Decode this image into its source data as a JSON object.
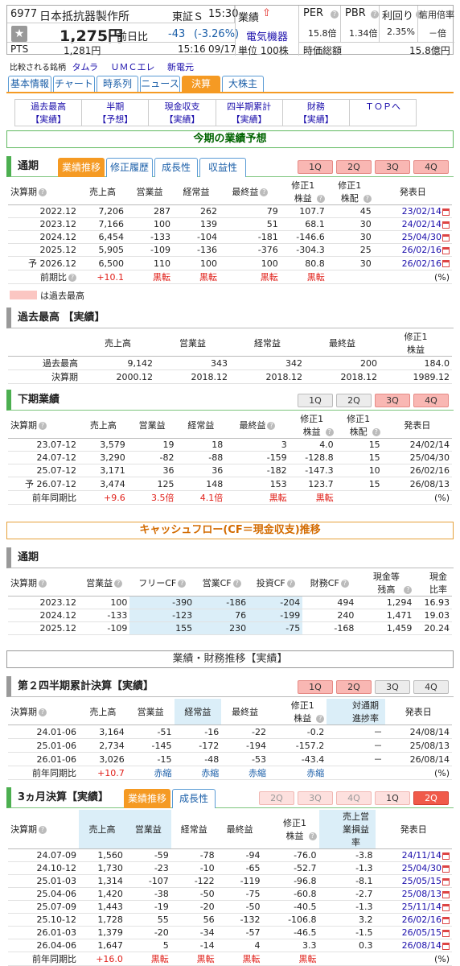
{
  "header": {
    "code": "6977",
    "name": "日本抵抗器製作所",
    "market": "東証Ｓ",
    "time": "15:30",
    "price": "1,275円",
    "prev_label": "前日比",
    "change": "-43",
    "change_pct": "(-3.26%)",
    "sector_label": "業績",
    "sector": "電気機器",
    "unit": "単位 100株",
    "per_label": "PER",
    "per": "15.8倍",
    "pbr_label": "PBR",
    "pbr": "1.34倍",
    "yield_label": "利回り",
    "yield": "2.35%",
    "margin_label": "信用倍率",
    "margin": "－倍",
    "pts_label": "PTS",
    "pts_price": "1,281円",
    "pts_time": "15:16",
    "pts_date": "09/17",
    "mcap_label": "時価総額",
    "mcap": "15.8億円",
    "compare_label": "比較される銘柄",
    "compare": [
      "タムラ",
      "ＵＭＣエレ",
      "新電元"
    ]
  },
  "tabs": [
    "基本情報",
    "チャート",
    "時系列",
    "ニュース",
    "決算",
    "大株主"
  ],
  "subnav": [
    [
      "過去最高",
      "【実績】"
    ],
    [
      "半期",
      "【予想】"
    ],
    [
      "現金収支",
      "【実績】"
    ],
    [
      "四半期累計",
      "【実績】"
    ],
    [
      "財務",
      "【実績】"
    ],
    [
      "ＴＯＰへ",
      ""
    ]
  ],
  "forecast": {
    "title": "今期の業績予想",
    "bar": "通期",
    "tabs": [
      "業績推移",
      "修正履歴",
      "成長性",
      "収益性"
    ],
    "q": [
      "1Q",
      "2Q",
      "3Q",
      "4Q"
    ],
    "headers": [
      "決算期",
      "売上高",
      "営業益",
      "経常益",
      "最終益",
      "修正1株益",
      "修正1株配",
      "発表日"
    ],
    "rows": [
      [
        "2022.12",
        "7,206",
        "287",
        "262",
        "79",
        "107.7",
        "45",
        "23/02/14"
      ],
      [
        "2023.12",
        "7,166",
        "100",
        "139",
        "51",
        "68.1",
        "30",
        "24/02/14"
      ],
      [
        "2024.12",
        "6,454",
        "-133",
        "-104",
        "-181",
        "-146.6",
        "30",
        "25/04/30"
      ],
      [
        "2025.12",
        "5,905",
        "-109",
        "-136",
        "-376",
        "-304.3",
        "25",
        "26/02/16"
      ],
      [
        "予 2026.12",
        "6,500",
        "110",
        "100",
        "100",
        "80.8",
        "30",
        "26/02/16"
      ]
    ],
    "cmp": [
      "前期比",
      "+10.1",
      "黒転",
      "黒転",
      "黒転",
      "黒転",
      "",
      "(%)"
    ],
    "legend": "は過去最高"
  },
  "record": {
    "bar": "過去最高 【実績】",
    "headers": [
      "売上高",
      "営業益",
      "経常益",
      "最終益",
      "修正1株益"
    ],
    "rows": [
      [
        "過去最高",
        "9,142",
        "343",
        "342",
        "200",
        "184.0"
      ],
      [
        "決算期",
        "2000.12",
        "2018.12",
        "2018.12",
        "2018.12",
        "1989.12"
      ]
    ]
  },
  "half": {
    "bar": "下期業績",
    "q": [
      "1Q",
      "2Q",
      "3Q",
      "4Q"
    ],
    "headers": [
      "決算期",
      "売上高",
      "営業益",
      "経常益",
      "最終益",
      "修正1株益",
      "修正1株配",
      "発表日"
    ],
    "rows": [
      [
        "23.07-12",
        "3,579",
        "19",
        "18",
        "3",
        "4.0",
        "15",
        "24/02/14"
      ],
      [
        "24.07-12",
        "3,290",
        "-82",
        "-88",
        "-159",
        "-128.8",
        "15",
        "25/04/30"
      ],
      [
        "25.07-12",
        "3,171",
        "36",
        "36",
        "-182",
        "-147.3",
        "10",
        "26/02/16"
      ],
      [
        "予 26.07-12",
        "3,474",
        "125",
        "148",
        "153",
        "123.7",
        "15",
        "26/08/13"
      ]
    ],
    "cmp": [
      "前年同期比",
      "+9.6",
      "3.5倍",
      "4.1倍",
      "黒転",
      "黒転",
      "",
      "(%)"
    ]
  },
  "cf": {
    "title": "キャッシュフロー(CF＝現金収支)推移",
    "bar": "通期",
    "headers": [
      "決算期",
      "営業益",
      "フリーCF",
      "営業CF",
      "投資CF",
      "財務CF",
      "現金等残高",
      "現金比率"
    ],
    "rows": [
      [
        "2023.12",
        "100",
        "-390",
        "-186",
        "-204",
        "494",
        "1,294",
        "16.93"
      ],
      [
        "2024.12",
        "-133",
        "-123",
        "76",
        "-199",
        "240",
        "1,471",
        "19.03"
      ],
      [
        "2025.12",
        "-109",
        "155",
        "230",
        "-75",
        "-168",
        "1,459",
        "20.24"
      ]
    ]
  },
  "trend": {
    "title": "業績・財務推移【実績】"
  },
  "cum": {
    "bar": "第２四半期累計決算【実績】",
    "q": [
      "1Q",
      "2Q",
      "3Q",
      "4Q"
    ],
    "headers": [
      "決算期",
      "売上高",
      "営業益",
      "経常益",
      "最終益",
      "修正1株益",
      "対通期進捗率",
      "発表日"
    ],
    "rows": [
      [
        "24.01-06",
        "3,164",
        "-51",
        "-16",
        "-22",
        "-0.2",
        "－",
        "24/08/14"
      ],
      [
        "25.01-06",
        "2,734",
        "-145",
        "-172",
        "-194",
        "-157.2",
        "－",
        "25/08/13"
      ],
      [
        "26.01-06",
        "3,026",
        "-15",
        "-48",
        "-53",
        "-43.4",
        "－",
        "26/08/14"
      ]
    ],
    "cmp": [
      "前年同期比",
      "+10.7",
      "赤縮",
      "赤縮",
      "赤縮",
      "赤縮",
      "",
      "(%)"
    ]
  },
  "q3m": {
    "bar": "3ヵ月決算【実績】",
    "tabs": [
      "業績推移",
      "成長性"
    ],
    "q": [
      "2Q",
      "3Q",
      "4Q",
      "1Q",
      "2Q"
    ],
    "headers": [
      "決算期",
      "売上高",
      "営業益",
      "経常益",
      "最終益",
      "修正1株益",
      "売上営業損益率",
      "発表日"
    ],
    "rows": [
      [
        "24.07-09",
        "1,560",
        "-59",
        "-78",
        "-94",
        "-76.0",
        "-3.8",
        "24/11/14"
      ],
      [
        "24.10-12",
        "1,730",
        "-23",
        "-10",
        "-65",
        "-52.7",
        "-1.3",
        "25/04/30"
      ],
      [
        "25.01-03",
        "1,314",
        "-107",
        "-122",
        "-119",
        "-96.8",
        "-8.1",
        "25/05/15"
      ],
      [
        "25.04-06",
        "1,420",
        "-38",
        "-50",
        "-75",
        "-60.8",
        "-2.7",
        "25/08/13"
      ],
      [
        "25.07-09",
        "1,443",
        "-19",
        "-20",
        "-50",
        "-40.5",
        "-1.3",
        "25/11/14"
      ],
      [
        "25.10-12",
        "1,728",
        "55",
        "56",
        "-132",
        "-106.8",
        "3.2",
        "26/02/16"
      ],
      [
        "26.01-03",
        "1,379",
        "-20",
        "-34",
        "-57",
        "-46.5",
        "-1.5",
        "26/05/15"
      ],
      [
        "26.04-06",
        "1,647",
        "5",
        "-14",
        "4",
        "3.3",
        "0.3",
        "26/08/14"
      ]
    ],
    "cmp": [
      "前年同期比",
      "+16.0",
      "黒転",
      "黒転",
      "黒転",
      "黒転",
      "",
      "(%)"
    ]
  }
}
